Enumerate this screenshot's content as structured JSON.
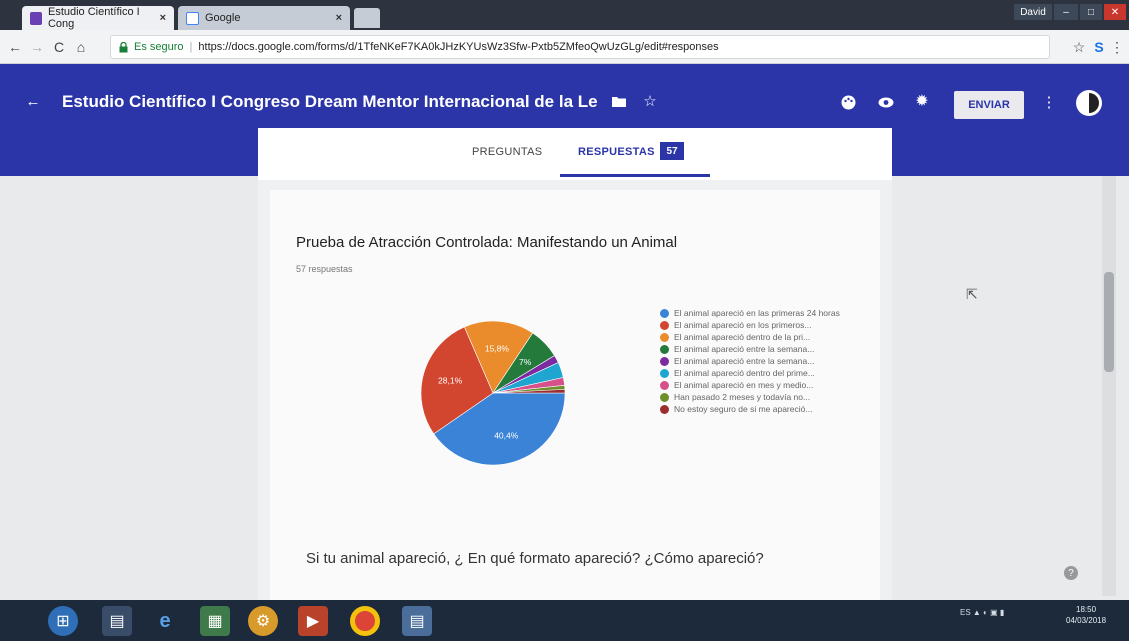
{
  "browser": {
    "tabs": [
      {
        "title": "Estudio Científico I Cong",
        "close": "×"
      },
      {
        "title": "Google",
        "close": "×"
      }
    ],
    "window_user": "David",
    "url_secure_label": "Es seguro",
    "url": "https://docs.google.com/forms/d/1TfeNKeF7KA0kJHzKYUsWz3Sfw-Pxtb5ZMfeoQwUzGLg/edit#responses"
  },
  "form": {
    "title": "Estudio Científico I Congreso Dream Mentor Internacional de la Le",
    "send_label": "ENVIAR",
    "tabs": [
      {
        "label": "PREGUNTAS"
      },
      {
        "label": "RESPUESTAS",
        "count": "57"
      }
    ]
  },
  "question1": {
    "title": "Prueba de Atracción Controlada: Manifestando un Animal",
    "responses_label": "57 respuestas"
  },
  "question2": {
    "title": "Si tu animal apareció, ¿ En qué formato apareció? ¿Cómo apareció?"
  },
  "chart_data": {
    "type": "pie",
    "slices": [
      {
        "label": "El animal apareció en las primeras 24 horas",
        "value": 40.4,
        "display": "40,4%",
        "color": "#3a83d6"
      },
      {
        "label": "El animal apareció en los primeros...",
        "value": 28.1,
        "display": "28,1%",
        "color": "#d2452f"
      },
      {
        "label": "El animal apareció dentro de la pri...",
        "value": 15.8,
        "display": "15,8%",
        "color": "#ea8c2c"
      },
      {
        "label": "El animal apareció entre la semana...",
        "value": 7.0,
        "display": "7%",
        "color": "#237a3a"
      },
      {
        "label": "El animal apareció entre la semana...",
        "value": 1.75,
        "display": "",
        "color": "#7b2aa0"
      },
      {
        "label": "El animal apareció dentro del prime...",
        "value": 3.5,
        "display": "",
        "color": "#1ea5d0"
      },
      {
        "label": "El animal apareció en mes y medio...",
        "value": 1.75,
        "display": "",
        "color": "#d6518a"
      },
      {
        "label": "Han pasado 2 meses y todavía no...",
        "value": 0.9,
        "display": "",
        "color": "#6f8f2a"
      },
      {
        "label": "No estoy seguro de si me apareció...",
        "value": 0.8,
        "display": "",
        "color": "#9a2e2e"
      }
    ]
  },
  "taskbar": {
    "clock_time": "18:50",
    "clock_date": "04/03/2018",
    "tray_lang": "ES"
  }
}
